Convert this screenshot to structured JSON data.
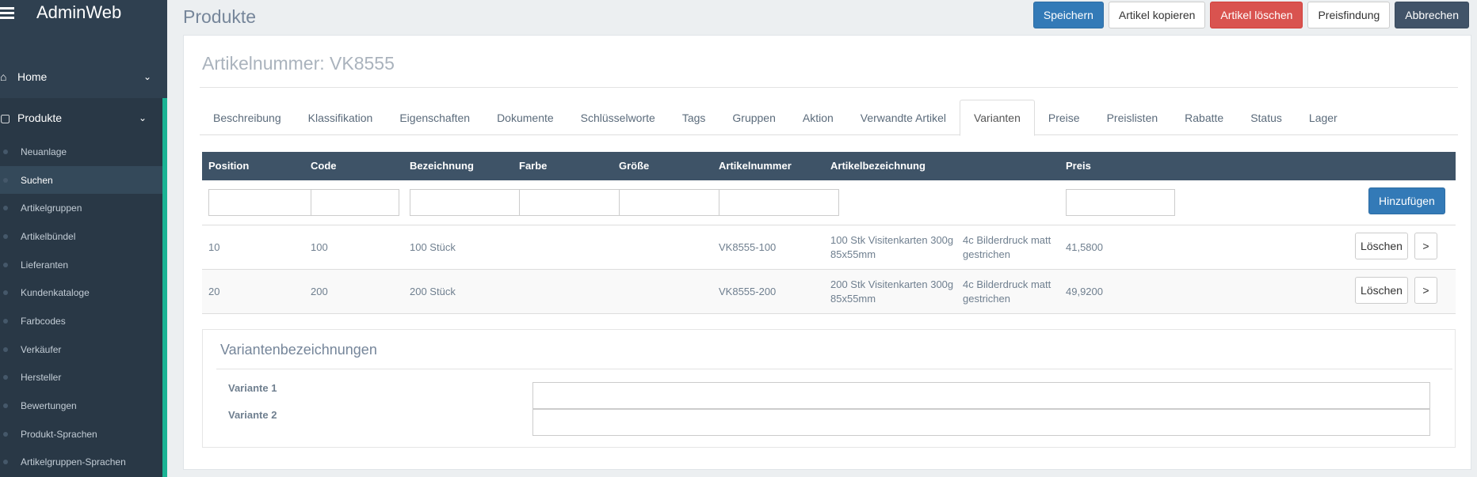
{
  "app": {
    "title": "AdminWeb"
  },
  "sidebar": {
    "items": [
      {
        "label": "Home",
        "icon": "home-icon"
      },
      {
        "label": "Produkte",
        "icon": "cube-icon"
      }
    ],
    "subitems": [
      "Neuanlage",
      "Suchen",
      "Artikelgruppen",
      "Artikelbündel",
      "Lieferanten",
      "Kundenkataloge",
      "Farbcodes",
      "Verkäufer",
      "Hersteller",
      "Bewertungen",
      "Produkt-Sprachen",
      "Artikelgruppen-Sprachen"
    ],
    "active_sub": "Suchen"
  },
  "header": {
    "title": "Produkte",
    "buttons": {
      "save": "Speichern",
      "copy": "Artikel kopieren",
      "delete": "Artikel löschen",
      "pricing": "Preisfindung",
      "cancel": "Abbrechen"
    }
  },
  "card": {
    "title": "Artikelnummer: VK8555",
    "tabs": [
      "Beschreibung",
      "Klassifikation",
      "Eigenschaften",
      "Dokumente",
      "Schlüsselworte",
      "Tags",
      "Gruppen",
      "Aktion",
      "Verwandte Artikel",
      "Varianten",
      "Preise",
      "Preislisten",
      "Rabatte",
      "Status",
      "Lager"
    ],
    "active_tab": "Varianten"
  },
  "table": {
    "headers": [
      "Position",
      "Code",
      "Bezeichnung",
      "Farbe",
      "Größe",
      "Artikelnummer",
      "Artikelbezeichnung",
      "Preis"
    ],
    "add_label": "Hinzufügen",
    "rows": [
      {
        "position": "10",
        "code": "100",
        "bezeichnung": "100 Stück",
        "artikelnummer": "VK8555-100",
        "bez1": "100 Stk Visitenkarten 300g",
        "bez1b": "85x55mm",
        "bez2": "4c Bilderdruck matt",
        "bez2b": "gestrichen",
        "preis": "41,5800"
      },
      {
        "position": "20",
        "code": "200",
        "bezeichnung": "200 Stück",
        "artikelnummer": "VK8555-200",
        "bez1": "200 Stk Visitenkarten 300g",
        "bez1b": "85x55mm",
        "bez2": "4c Bilderdruck matt",
        "bez2b": "gestrichen",
        "preis": "49,9200"
      }
    ],
    "delete_label": "Löschen",
    "next_label": ">"
  },
  "varianten": {
    "title": "Variantenbezeichnungen",
    "labels": [
      "Variante 1",
      "Variante 2"
    ]
  }
}
